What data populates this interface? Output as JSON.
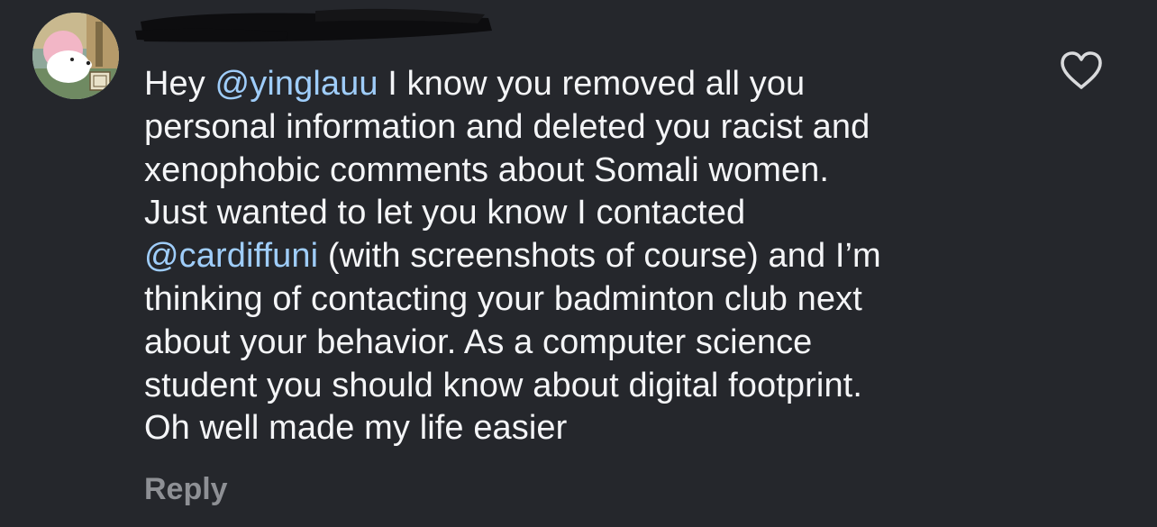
{
  "comment": {
    "mentions": {
      "first": "@yinglauu",
      "second": "@cardiffuni"
    },
    "lines": {
      "l1_pre": "Hey ",
      "l1_post": " I know you removed all you",
      "l2": "personal information and deleted you racist and",
      "l3": "xenophobic comments about Somali women.",
      "l4": "Just wanted to let you know I contacted",
      "l5_post": " (with screenshots of course) and I’m",
      "l6": "thinking of contacting your badminton club next",
      "l7": "about your behavior. As a computer science",
      "l8": "student you should know about digital footprint.",
      "l9": "Oh well made my life easier"
    },
    "reply_label": "Reply"
  },
  "icons": {
    "like": "heart-outline-icon",
    "avatar": "user-avatar"
  },
  "colors": {
    "background": "#25272c",
    "text": "#f4f5f7",
    "mention": "#9fcdfa",
    "secondary": "#8e9095"
  }
}
